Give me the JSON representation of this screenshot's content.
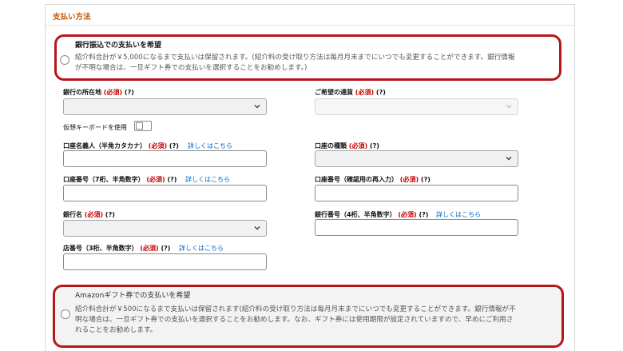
{
  "section": {
    "title": "支払い方法"
  },
  "bank_option": {
    "title": "銀行振込での支払いを希望",
    "desc_line1": "紹介料合計が￥5,000になるまで支払いは保留されます。(紹介料の受け取り方法は毎月月末までにいつでも変更することができます。銀行情報",
    "desc_line2": "が不明な場合は、一旦ギフト券での支払いを選択することをお勧めします。)"
  },
  "form": {
    "required": "(必須)",
    "hint": "(?)",
    "details_link": "詳しくはこちら",
    "bank_location": {
      "label": "銀行の所在地",
      "value": ""
    },
    "currency": {
      "label": "ご希望の通貨",
      "value": ""
    },
    "virtual_keyboard": {
      "label": "仮想キーボードを使用",
      "on": false
    },
    "account_holder": {
      "label": "口座名義人（半角カタカナ）",
      "value": ""
    },
    "account_type": {
      "label": "口座の種類",
      "value": ""
    },
    "account_number": {
      "label": "口座番号（7桁、半角数字）",
      "value": ""
    },
    "account_number_confirm": {
      "label": "口座番号（確認用の再入力）",
      "value": ""
    },
    "bank_name": {
      "label": "銀行名",
      "value": ""
    },
    "bank_number": {
      "label": "銀行番号（4桁、半角数字）",
      "value": ""
    },
    "branch_number": {
      "label": "店番号（3桁、半角数字）",
      "value": ""
    }
  },
  "gift_option": {
    "title": "Amazonギフト券での支払いを希望",
    "desc_line1": "紹介料合計が￥500になるまで支払いは保留されます(紹介料の受け取り方法は毎月月末までにいつでも変更することができます。銀行情報が不",
    "desc_line2": "明な場合は、一旦ギフト券での支払いを選択することをお勧めします。なお、ギフト券には使用期限が設定されていますので、早めにご利用さ",
    "desc_line3": "れることをお勧めします。"
  },
  "colors": {
    "highlight": "#b4161b",
    "required": "#c40000",
    "link": "#0066c0",
    "section_title": "#c45500"
  }
}
